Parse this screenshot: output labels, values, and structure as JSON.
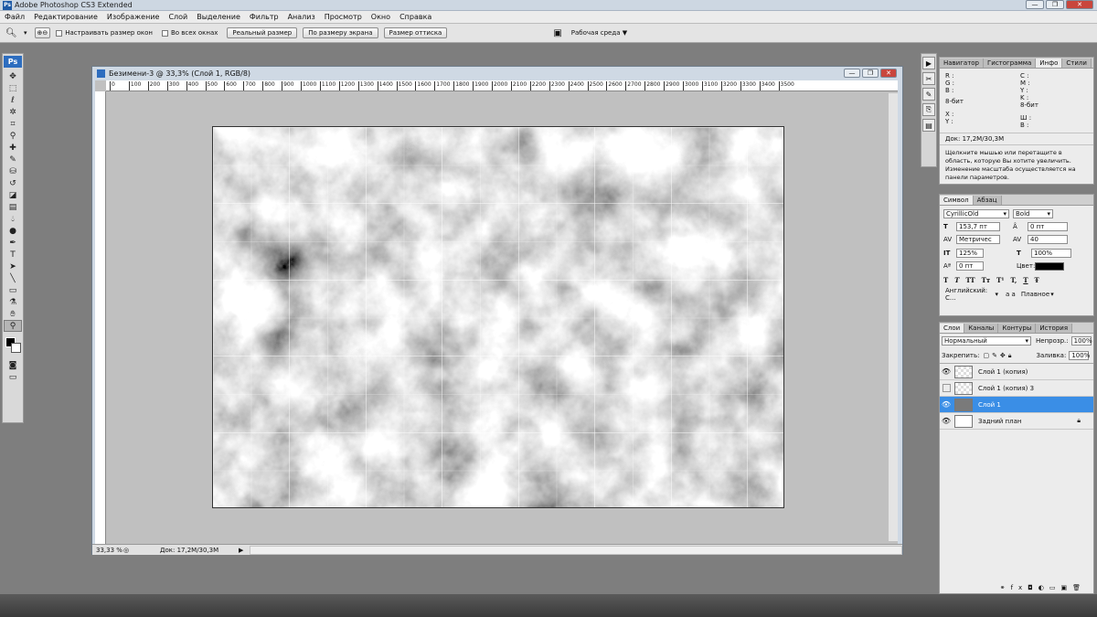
{
  "app": {
    "title": "Adobe Photoshop CS3 Extended",
    "logo": "Ps"
  },
  "window_controls": {
    "minimize": "—",
    "restore": "❐",
    "close": "✕"
  },
  "menu": [
    "Файл",
    "Редактирование",
    "Изображение",
    "Слой",
    "Выделение",
    "Фильтр",
    "Анализ",
    "Просмотр",
    "Окно",
    "Справка"
  ],
  "options": {
    "zoom_in_icon": "zoom-in-icon",
    "resize_windows": "Настраивать размер окон",
    "all_windows": "Во всех окнах",
    "actual_pixels": "Реальный размер",
    "fit_screen": "По размеру экрана",
    "print_size": "Размер оттиска",
    "workspace": "Рабочая среда"
  },
  "document": {
    "title": "Безимени-3 @ 33,3% (Слой 1, RGB/8)",
    "zoom": "33,33 %",
    "doc_size": "Док: 17,2M/30,3M",
    "ruler_ticks": [
      "0",
      "100",
      "200",
      "300",
      "400",
      "500",
      "600",
      "700",
      "800",
      "900",
      "1000",
      "1100",
      "1200",
      "1300",
      "1400",
      "1500",
      "1600",
      "1700",
      "1800",
      "1900",
      "2000",
      "2100",
      "2200",
      "2300",
      "2400",
      "2500",
      "2600",
      "2700",
      "2800",
      "2900",
      "3000",
      "3100",
      "3200",
      "3300",
      "3400",
      "3500"
    ]
  },
  "toolbox": {
    "tools": [
      "move-tool",
      "marquee-tool",
      "lasso-tool",
      "magic-wand-tool",
      "crop-tool",
      "eyedropper-tool",
      "healing-tool",
      "brush-tool",
      "stamp-tool",
      "history-brush-tool",
      "eraser-tool",
      "gradient-tool",
      "blur-tool",
      "dodge-tool",
      "pen-tool",
      "type-tool",
      "path-select-tool",
      "line-tool",
      "notes-tool",
      "eyedropper2-tool",
      "hand-tool",
      "zoom-tool"
    ]
  },
  "nav_panel": {
    "tabs": [
      "Навигатор",
      "Гистограмма",
      "Инфо",
      "Стили"
    ],
    "r": "R :",
    "g": "G :",
    "b": "B :",
    "c": "C :",
    "m": "M :",
    "y": "Y :",
    "k": "K :",
    "bit1": "8-бит",
    "bit2": "8-бит",
    "x": "X :",
    "yy": "Y :",
    "w": "Ш :",
    "h": "В :",
    "doc": "Док: 17,2M/30,3M",
    "hint": "Щелкните мышью или перетащите в область, которую Вы хотите увеличить. Изменение масштаба осуществляется на панели параметров."
  },
  "char_panel": {
    "tabs": [
      "Символ",
      "Абзац"
    ],
    "font": "CyrillicOld",
    "style": "Bold",
    "size": "153,7 пт",
    "leading": "0 пт",
    "kerning": "Метричес",
    "tracking": "40",
    "vscale": "125%",
    "hscale": "100%",
    "baseline": "0 пт",
    "color_label": "Цвет:",
    "language": "Английский: С...",
    "aa_label": "а а",
    "aa": "Плавное",
    "styles": [
      "T",
      "T",
      "TT",
      "Tт",
      "T¹",
      "T,",
      "T",
      "Ŧ"
    ]
  },
  "layers_panel": {
    "tabs": [
      "Слои",
      "Каналы",
      "Контуры",
      "История"
    ],
    "blend": "Нормальный",
    "opacity_label": "Непрозр.:",
    "opacity": "100%",
    "lock_label": "Закрепить:",
    "fill_label": "Заливка:",
    "fill": "100%",
    "layers": [
      {
        "name": "Слой 1 (копия)",
        "visible": "👁"
      },
      {
        "name": "Слой 1 (копия) 3",
        "visible": ""
      },
      {
        "name": "Слой 1",
        "visible": "👁"
      },
      {
        "name": "Задний план",
        "visible": "👁"
      }
    ],
    "footer": [
      "⚭",
      "fx",
      "◘",
      "◐",
      "▭",
      "▣",
      "🗑"
    ]
  }
}
